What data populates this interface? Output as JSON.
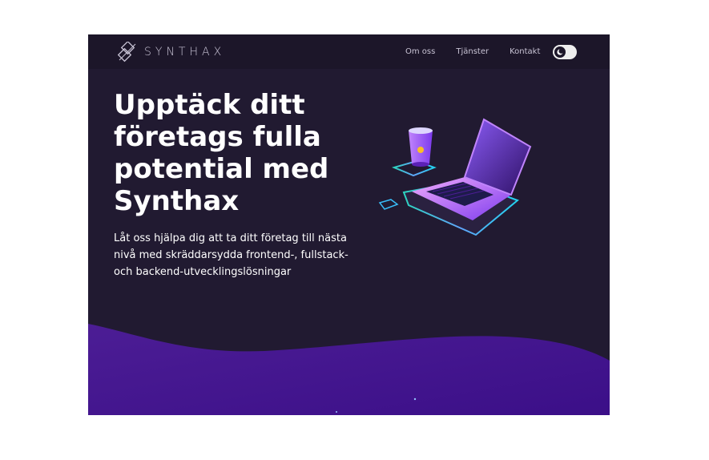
{
  "brand": {
    "name": "SYNTHAX"
  },
  "nav": {
    "items": [
      "Om oss",
      "Tjänster",
      "Kontakt"
    ]
  },
  "theme_toggle": {
    "icon": "moon-icon"
  },
  "hero": {
    "headline": "Upptäck ditt företags fulla potential med Synthax",
    "subtext": "Låt oss hjälpa dig att ta ditt företag till nästa nivå med skräddarsydda frontend-, fullstack- och backend-utvecklingslösningar"
  },
  "colors": {
    "background": "#211a31",
    "navbar": "#1c1629",
    "wave": "#4a1a9e",
    "accent": "#7b3ff2"
  }
}
